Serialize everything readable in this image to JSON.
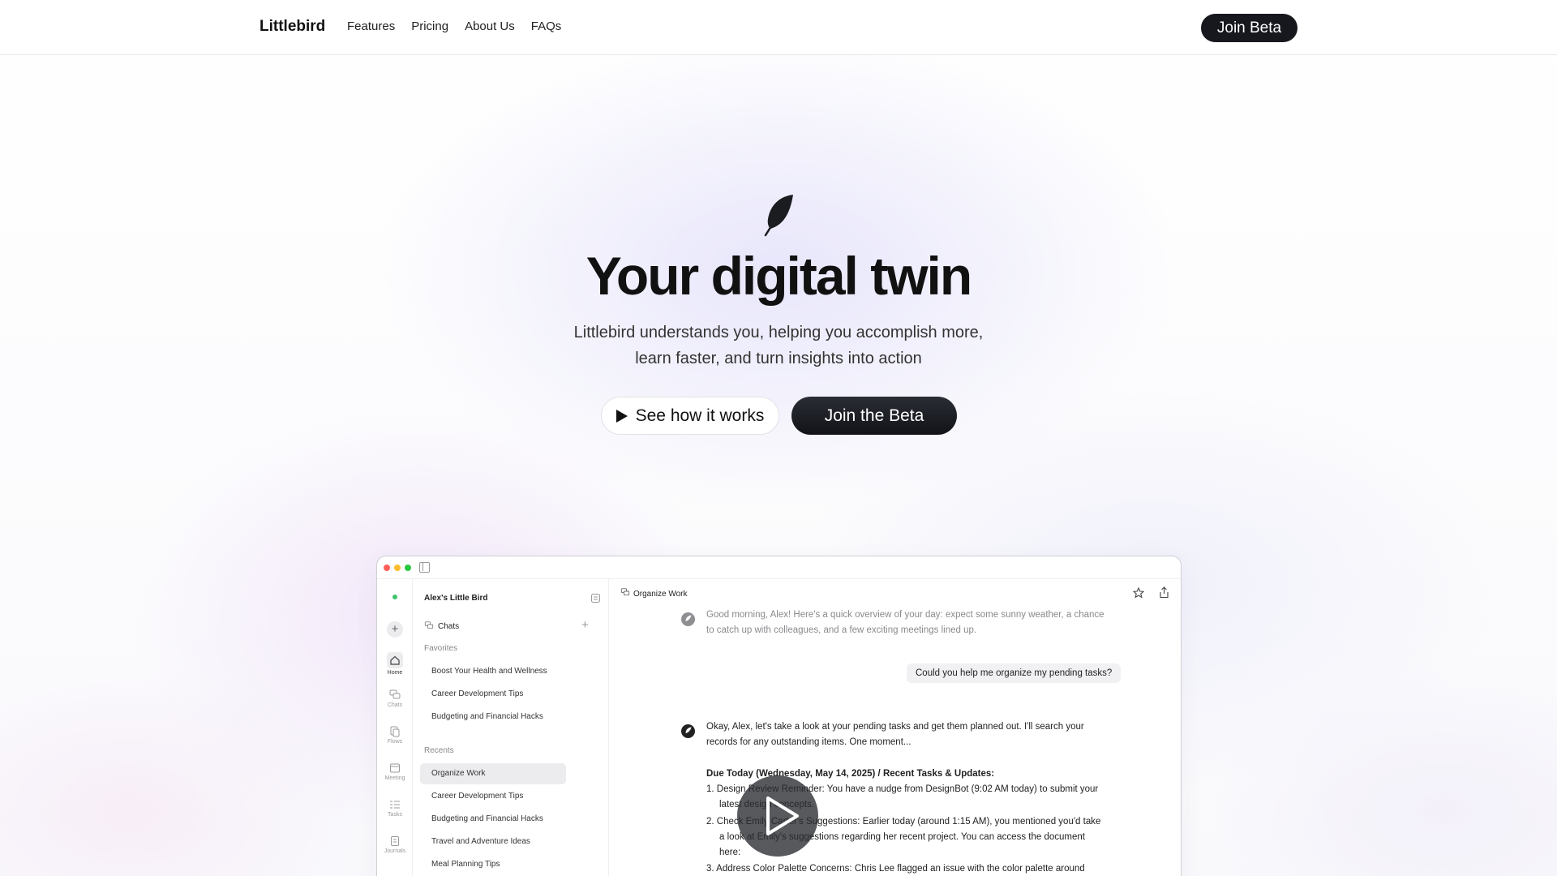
{
  "nav": {
    "brand": "Littlebird",
    "links": [
      "Features",
      "Pricing",
      "About Us",
      "FAQs"
    ],
    "cta": "Join Beta"
  },
  "hero": {
    "title": "Your digital twin",
    "subtitle_line1": "Littlebird understands you, helping you accomplish more,",
    "subtitle_line2": "learn faster, and turn insights into action",
    "see_how": "See how it works",
    "join": "Join the Beta"
  },
  "app": {
    "rail": [
      "Home",
      "Chats",
      "Flows",
      "Meeting",
      "Tasks",
      "Journals"
    ],
    "sidebar": {
      "title": "Alex's Little Bird",
      "chats_label": "Chats",
      "favorites_label": "Favorites",
      "favorites": [
        "Boost Your Health and Wellness",
        "Career Development Tips",
        "Budgeting and Financial Hacks"
      ],
      "recents_label": "Recents",
      "recents": [
        "Organize Work",
        "Career Development Tips",
        "Budgeting and Financial Hacks",
        "Travel and Adventure Ideas",
        "Meal Planning Tips"
      ]
    },
    "chat": {
      "title": "Organize Work",
      "greeting_1": "Good morning, Alex! Here's a quick overview of your day: expect some sunny weather, a chance",
      "greeting_2": "to catch up with colleagues, and a few exciting meetings lined up.",
      "user_msg": "Could you help me organize my pending tasks?",
      "reply_1": "Okay, Alex, let's take a look at your pending tasks and get them planned out. I'll search your",
      "reply_2": "records for any outstanding items. One moment...",
      "heading": "Due Today (Wednesday, May 14, 2025) / Recent Tasks & Updates:",
      "item1_a": "1. Design Review Reminder: You have a nudge from DesignBot (9:02 AM today) to submit your",
      "item1_b": "latest design concepts.",
      "item2_a": "2. Check Emily Carter's Suggestions: Earlier today (around 1:15 AM), you mentioned you'd take",
      "item2_b": "a look at Emily's suggestions regarding her recent project. You can access the document",
      "item2_c": "here:",
      "item3_a": "3. Address Color Palette Concerns: Chris Lee flagged an issue with the color palette around"
    }
  },
  "colors": {
    "dark": "#16181d",
    "traffic_red": "#ff5f57",
    "traffic_yellow": "#febc2e",
    "traffic_green": "#28c840"
  }
}
